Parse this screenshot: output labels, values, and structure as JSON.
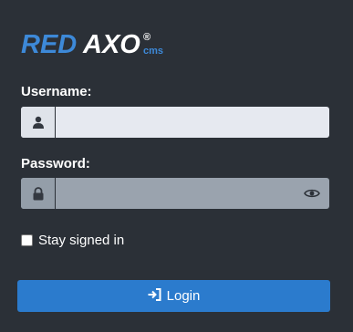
{
  "logo": {
    "text_red": "RED",
    "text_axo": "AXO",
    "registered": "®",
    "suffix": "cms"
  },
  "form": {
    "username_label": "Username:",
    "username_value": "",
    "password_label": "Password:",
    "password_value": "",
    "remember_label": "Stay signed in",
    "remember_checked": false,
    "login_label": "Login"
  },
  "icons": {
    "user": "user-icon",
    "lock": "lock-icon",
    "eye": "eye-icon",
    "login": "sign-in-icon"
  },
  "colors": {
    "background": "#2b3037",
    "logo_blue": "#3d89d8",
    "button": "#2b7bcd"
  }
}
